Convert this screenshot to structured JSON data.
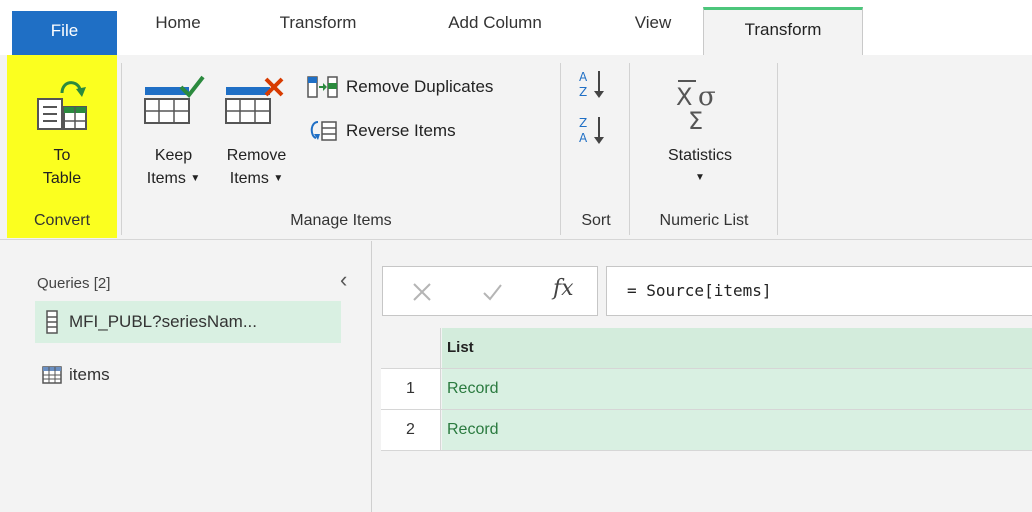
{
  "tabs": {
    "file": "File",
    "home": "Home",
    "transform": "Transform",
    "add_column": "Add Column",
    "view": "View",
    "transform_active": "Transform"
  },
  "ribbon": {
    "convert": {
      "btn_line1": "To",
      "btn_line2": "Table",
      "group": "Convert"
    },
    "manage_items": {
      "keep_line1": "Keep",
      "keep_line2": "Items",
      "remove_line1": "Remove",
      "remove_line2": "Items",
      "remove_duplicates": "Remove Duplicates",
      "reverse_items": "Reverse Items",
      "group": "Manage Items"
    },
    "sort": {
      "group": "Sort"
    },
    "numeric_list": {
      "statistics": "Statistics",
      "group": "Numeric List"
    }
  },
  "queries": {
    "header": "Queries [2]",
    "items": [
      {
        "name": "MFI_PUBL?seriesNam...",
        "icon": "list-icon",
        "selected": true
      },
      {
        "name": "items",
        "icon": "table-icon",
        "selected": false
      }
    ]
  },
  "formula_bar": {
    "fx": "fx",
    "formula": "= Source[items]"
  },
  "grid": {
    "column_header": "List",
    "rows": [
      {
        "index": "1",
        "value": "Record"
      },
      {
        "index": "2",
        "value": "Record"
      }
    ]
  },
  "colors": {
    "file_tab": "#1f6fc5",
    "active_tab_accent": "#4cc67b",
    "highlight": "#fbff1f",
    "selected_row": "#d9f0e2",
    "record_text": "#2a7a3f"
  }
}
